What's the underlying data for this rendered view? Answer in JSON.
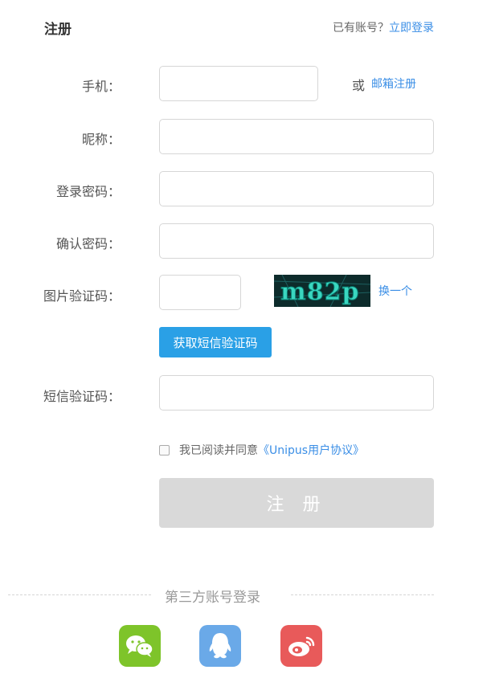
{
  "header": {
    "title": "注册",
    "has_account_text": "已有账号？",
    "login_link": "立即登录"
  },
  "form": {
    "phone_label": "手机：",
    "or_text": "或",
    "email_register_link": "邮箱注册",
    "nickname_label": "昵称：",
    "password_label": "登录密码：",
    "confirm_password_label": "确认密码：",
    "image_captcha_label": "图片验证码：",
    "captcha_text": "m82p",
    "refresh_captcha_link": "换一个",
    "get_sms_code_button": "获取短信验证码",
    "sms_code_label": "短信验证码：",
    "agree_text": "我已阅读并同意",
    "agreement_link": "《Unipus用户协议》",
    "register_button": "注 册"
  },
  "third_party": {
    "title": "第三方账号登录",
    "providers": [
      "wechat",
      "qq",
      "weibo"
    ]
  },
  "colors": {
    "link": "#3a8ee6",
    "sms_button": "#2aa0e6",
    "register_button_disabled": "#d9d9d9",
    "wechat": "#7ec42a",
    "qq": "#6aa9e8",
    "weibo": "#e85a5a"
  }
}
